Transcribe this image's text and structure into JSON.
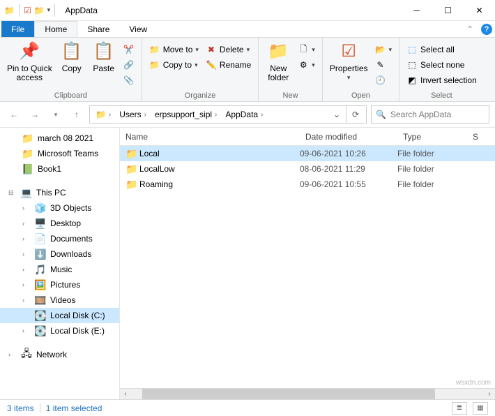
{
  "window": {
    "title": "AppData"
  },
  "tabs": {
    "file": "File",
    "home": "Home",
    "share": "Share",
    "view": "View"
  },
  "ribbon": {
    "clipboard": {
      "label": "Clipboard",
      "pin": "Pin to Quick\naccess",
      "copy": "Copy",
      "paste": "Paste"
    },
    "organize": {
      "label": "Organize",
      "moveto": "Move to",
      "copyto": "Copy to",
      "delete": "Delete",
      "rename": "Rename"
    },
    "new": {
      "label": "New",
      "newfolder": "New\nfolder"
    },
    "open": {
      "label": "Open",
      "properties": "Properties"
    },
    "select": {
      "label": "Select",
      "all": "Select all",
      "none": "Select none",
      "invert": "Invert selection"
    }
  },
  "breadcrumb": {
    "items": [
      "Users",
      "erpsupport_sipl",
      "AppData"
    ]
  },
  "search": {
    "placeholder": "Search AppData"
  },
  "nav": {
    "quick": [
      {
        "label": "march 08 2021",
        "icon": "📁"
      },
      {
        "label": "Microsoft Teams",
        "icon": "📁"
      },
      {
        "label": "Book1",
        "icon": "📗"
      }
    ],
    "thispc": "This PC",
    "pcitems": [
      {
        "label": "3D Objects",
        "icon": "🧊"
      },
      {
        "label": "Desktop",
        "icon": "🖥️"
      },
      {
        "label": "Documents",
        "icon": "📄"
      },
      {
        "label": "Downloads",
        "icon": "⬇️"
      },
      {
        "label": "Music",
        "icon": "🎵"
      },
      {
        "label": "Pictures",
        "icon": "🖼️"
      },
      {
        "label": "Videos",
        "icon": "🎞️"
      },
      {
        "label": "Local Disk (C:)",
        "icon": "💽",
        "sel": true
      },
      {
        "label": "Local Disk (E:)",
        "icon": "💽"
      }
    ],
    "network": "Network"
  },
  "columns": {
    "name": "Name",
    "date": "Date modified",
    "type": "Type",
    "size": "S"
  },
  "files": [
    {
      "name": "Local",
      "date": "09-06-2021 10:26",
      "type": "File folder",
      "sel": true
    },
    {
      "name": "LocalLow",
      "date": "08-06-2021 11:29",
      "type": "File folder"
    },
    {
      "name": "Roaming",
      "date": "09-06-2021 10:55",
      "type": "File folder"
    }
  ],
  "status": {
    "items": "3 items",
    "selected": "1 item selected"
  },
  "watermark": "wsxdn.com"
}
